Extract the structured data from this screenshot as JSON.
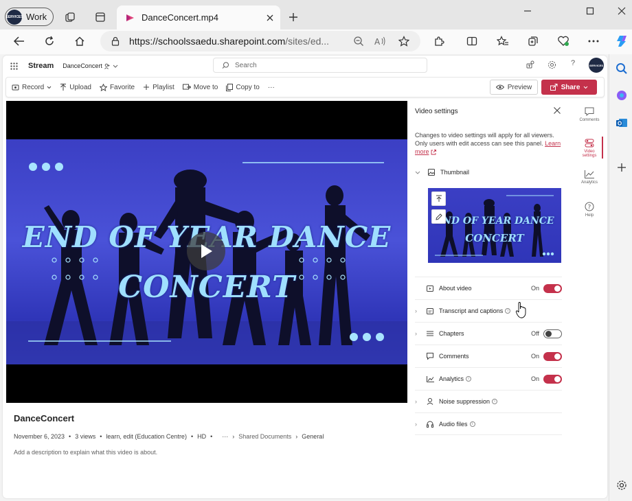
{
  "browser": {
    "profile_label": "Work",
    "profile_avatar_text": "SERVICES",
    "tab_title": "DanceConcert.mp4",
    "url_main": "https://schoolssaedu.sharepoint.com",
    "url_rest": "/sites/ed..."
  },
  "suite": {
    "app_name": "Stream",
    "breadcrumb": "DanceConcert",
    "search_placeholder": "Search",
    "avatar_text": "SERVICES"
  },
  "commands": {
    "record": "Record",
    "upload": "Upload",
    "favorite": "Favorite",
    "playlist": "Playlist",
    "move_to": "Move to",
    "copy_to": "Copy to",
    "more": "···",
    "preview": "Preview",
    "share": "Share"
  },
  "video": {
    "line1": "END OF YEAR DANCE",
    "line2": "CONCERT",
    "title": "DanceConcert",
    "date": "November 6, 2023",
    "views": "3 views",
    "permission": "learn, edit (Education Centre)",
    "quality": "HD",
    "more": "···",
    "path1": "Shared Documents",
    "path2": "General",
    "description_placeholder": "Add a description to explain what this video is about."
  },
  "settings": {
    "title": "Video settings",
    "note": "Changes to video settings will apply for all viewers. Only users with edit access can see this panel.",
    "learn_more": "Learn more",
    "thumbnail_label": "Thumbnail",
    "thumb_line1": "END OF YEAR DANCE",
    "thumb_line2": "CONCERT",
    "rows": [
      {
        "label": "About video",
        "state": "On"
      },
      {
        "label": "Transcript and captions",
        "state": ""
      },
      {
        "label": "Chapters",
        "state": "Off"
      },
      {
        "label": "Comments",
        "state": "On"
      },
      {
        "label": "Analytics",
        "state": "On"
      },
      {
        "label": "Noise suppression",
        "state": ""
      },
      {
        "label": "Audio files",
        "state": ""
      }
    ]
  },
  "rail": {
    "comments": "Comments",
    "video_settings": "Video settings",
    "analytics": "Analytics",
    "help": "Help"
  },
  "colors": {
    "accent": "#c4314b",
    "video_bg": "#3b3fc4",
    "video_text": "#9fdfff"
  }
}
